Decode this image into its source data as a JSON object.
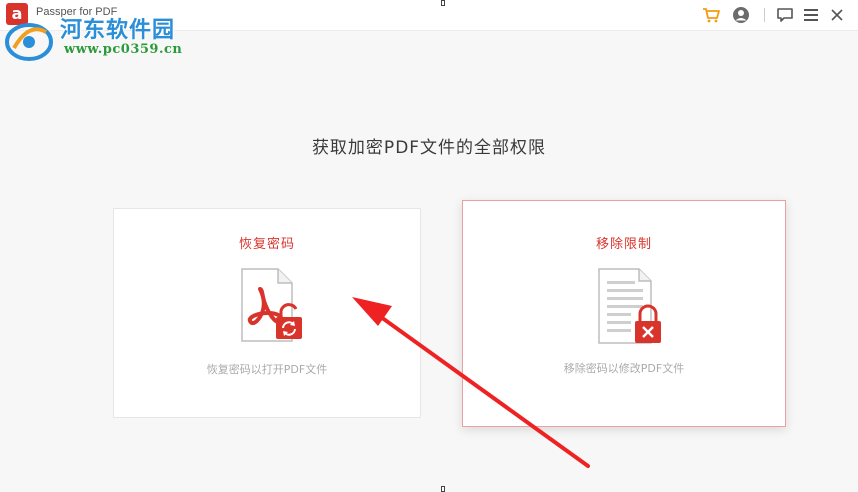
{
  "window": {
    "app_title": "Passper for PDF",
    "logo_letter": "a"
  },
  "watermark": {
    "site_name": "河东软件园",
    "url": "www.pc0359.cn"
  },
  "toolbar": {
    "icons": [
      "cart-icon",
      "user-icon",
      "feedback-icon",
      "menu-icon"
    ],
    "accent_color": "#f39c12"
  },
  "main": {
    "title": "获取加密PDF文件的全部权限",
    "cards": [
      {
        "title": "恢复密码",
        "description": "恢复密码以打开PDF文件",
        "icon": "pdf-unlock-icon"
      },
      {
        "title": "移除限制",
        "description": "移除密码以修改PDF文件",
        "icon": "document-lock-icon"
      }
    ]
  },
  "colors": {
    "brand_red": "#d9342b",
    "annotation_arrow": "#ee2222"
  }
}
